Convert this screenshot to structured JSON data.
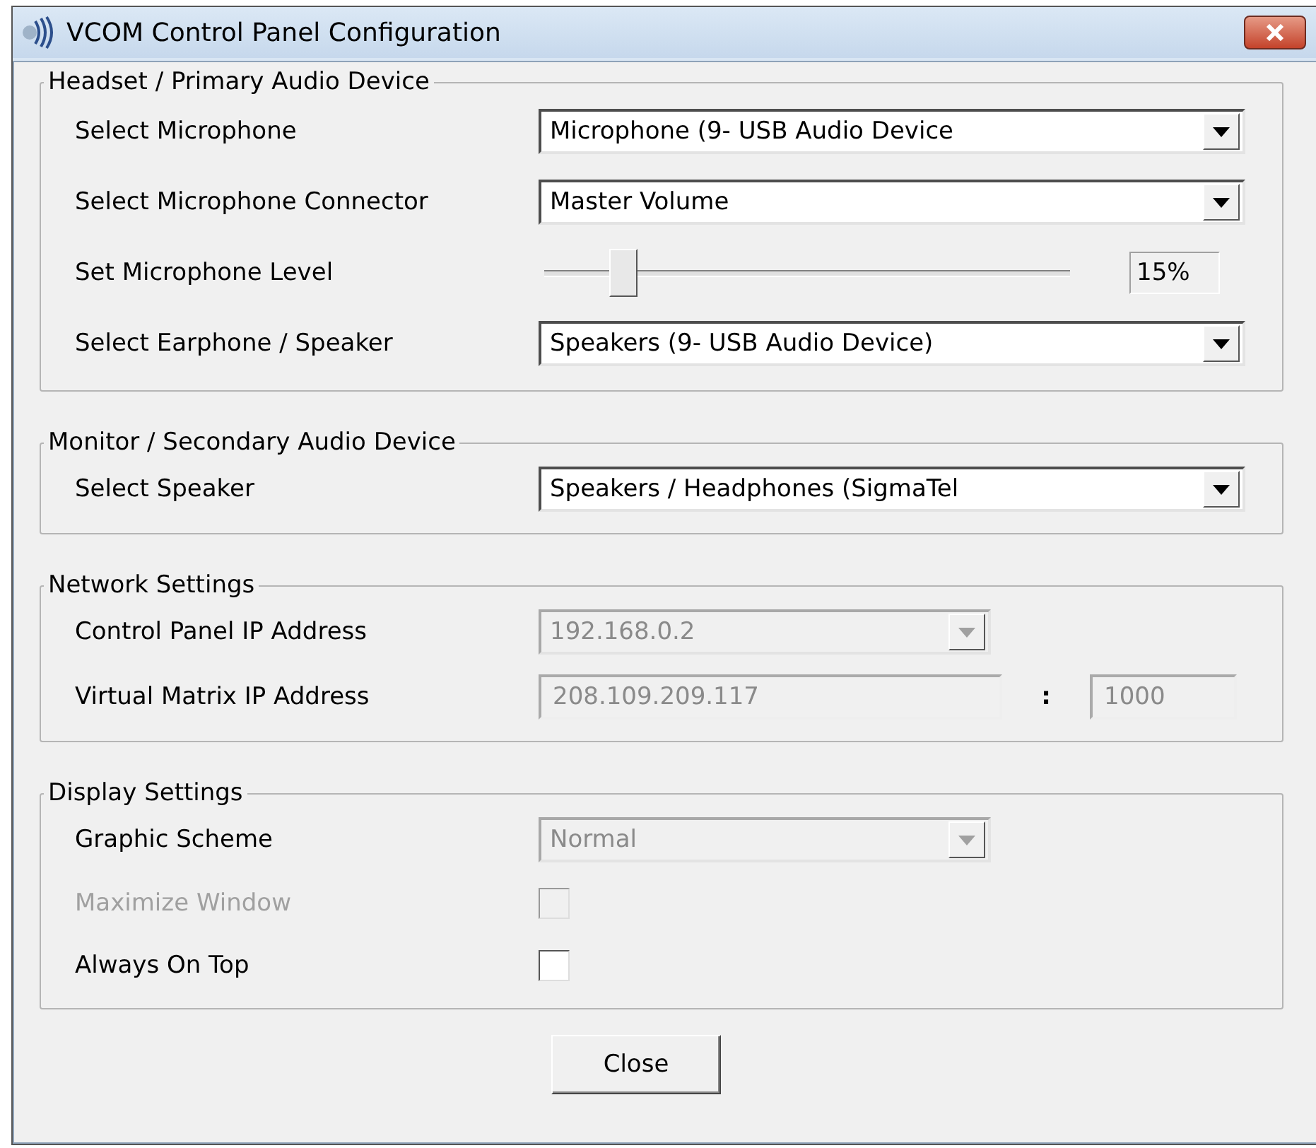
{
  "window": {
    "title": "VCOM Control Panel Configuration"
  },
  "groups": [
    {
      "title": "Headset / Primary Audio Device",
      "rows": [
        {
          "kind": "dropdown",
          "label": "Select Microphone",
          "value": "Microphone (9- USB Audio Device",
          "disabled": false
        },
        {
          "kind": "dropdown",
          "label": "Select Microphone Connector",
          "value": "Master Volume",
          "disabled": false
        },
        {
          "kind": "slider",
          "label": "Set Microphone Level",
          "level": 0.15,
          "reading": "15%"
        },
        {
          "kind": "dropdown",
          "label": "Select Earphone / Speaker",
          "value": "Speakers (9- USB Audio Device)",
          "disabled": false
        }
      ]
    },
    {
      "title": "Monitor / Secondary Audio Device",
      "rows": [
        {
          "kind": "dropdown",
          "label": "Select Speaker",
          "value": "Speakers / Headphones (SigmaTel",
          "disabled": false
        }
      ]
    },
    {
      "title": "Network Settings",
      "rows": [
        {
          "kind": "dropdown",
          "label": "Control Panel IP Address",
          "value": "192.168.0.2",
          "disabled": true,
          "short": true
        },
        {
          "kind": "address",
          "label": "Virtual Matrix IP Address",
          "value": "208.109.209.117",
          "separator": ":",
          "port": "1000",
          "disabled": true
        }
      ]
    },
    {
      "title": "Display Settings",
      "rows": [
        {
          "kind": "dropdown",
          "label": "Graphic Scheme",
          "value": "Normal",
          "disabled": true,
          "short": true
        },
        {
          "kind": "checkbox",
          "label": "Maximize Window",
          "checked": false,
          "disabled": true
        },
        {
          "kind": "checkbox",
          "label": "Always On Top",
          "checked": false,
          "disabled": false
        }
      ]
    }
  ],
  "buttons": [
    {
      "label": "Close"
    }
  ]
}
